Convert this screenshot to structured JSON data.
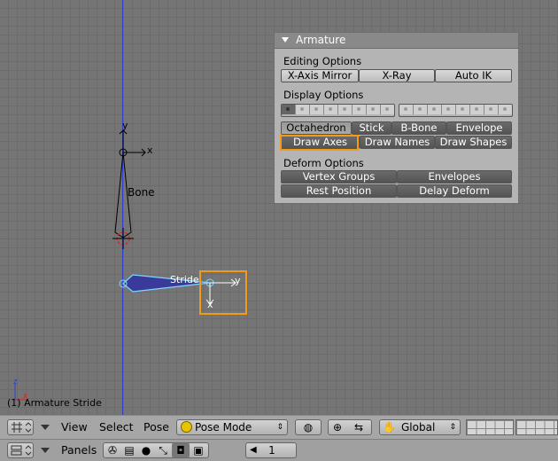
{
  "viewport": {
    "bone_label": "Bone",
    "stride_label": "Stride",
    "axis_x_label": "x",
    "axis_y_label": "y",
    "mini_axis_z": "z",
    "mini_axis_x": "x",
    "object_info": "(1) Armature Stride"
  },
  "panel": {
    "title": "Armature",
    "editing_label": "Editing Options",
    "editing_buttons": [
      "X-Axis Mirror",
      "X-Ray",
      "Auto IK"
    ],
    "display_label": "Display Options",
    "draw_type_buttons": [
      "Octahedron",
      "Stick",
      "B-Bone",
      "Envelope"
    ],
    "draw_option_buttons": [
      "Draw Axes",
      "Draw Names",
      "Draw Shapes"
    ],
    "deform_label": "Deform Options",
    "deform_buttons": [
      "Vertex Groups",
      "Envelopes",
      "Rest Position",
      "Delay Deform"
    ]
  },
  "header": {
    "menus": [
      "View",
      "Select",
      "Pose"
    ],
    "mode": "Pose Mode",
    "orientation": "Global"
  },
  "buttons_header": {
    "panels_label": "Panels",
    "frame": "1"
  },
  "colors": {
    "highlight": "#f39a1b",
    "bone_selected": "#7fd6ff",
    "bone_fill": "#3a3a9a"
  }
}
